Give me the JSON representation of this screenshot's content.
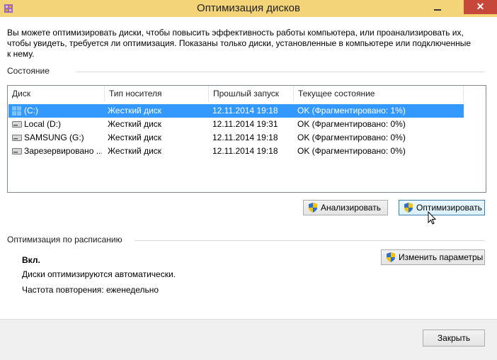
{
  "window": {
    "title": "Оптимизация дисков",
    "close_glyph": "✕",
    "accent_titlebar": "#f4d478",
    "selection_color": "#3399ff"
  },
  "description": "Вы можете оптимизировать диски, чтобы повысить эффективность работы  компьютера, или проанализировать их, чтобы увидеть, требуется ли оптимизация. Показаны только диски, установленные в компьютере или подключенные к нему.",
  "status_section": {
    "title": "Состояние",
    "columns": [
      "Диск",
      "Тип носителя",
      "Прошлый запуск",
      "Текущее состояние"
    ],
    "rows": [
      {
        "drive": "(C:)",
        "media": "Жесткий диск",
        "last_run": "12.11.2014 19:18",
        "status": "OK (Фрагментировано: 1%)",
        "icon": "windows-drive-icon",
        "selected": true
      },
      {
        "drive": "Local (D:)",
        "media": "Жесткий диск",
        "last_run": "12.11.2014 19:31",
        "status": "OK (Фрагментировано: 0%)",
        "icon": "hard-drive-icon",
        "selected": false
      },
      {
        "drive": "SAMSUNG (G:)",
        "media": "Жесткий диск",
        "last_run": "12.11.2014 19:18",
        "status": "OK (Фрагментировано: 0%)",
        "icon": "hard-drive-icon",
        "selected": false
      },
      {
        "drive": "Зарезервировано ...",
        "media": "Жесткий диск",
        "last_run": "12.11.2014 19:18",
        "status": "OK (Фрагментировано: 0%)",
        "icon": "hard-drive-icon",
        "selected": false
      }
    ],
    "analyze_label": "Анализировать",
    "optimize_label": "Оптимизировать"
  },
  "schedule_section": {
    "title": "Оптимизация по расписанию",
    "state": "Вкл.",
    "auto_text": "Диски оптимизируются автоматически.",
    "frequency": "Частота повторения: еженедельно",
    "change_label": "Изменить параметры"
  },
  "close_label": "Закрыть"
}
